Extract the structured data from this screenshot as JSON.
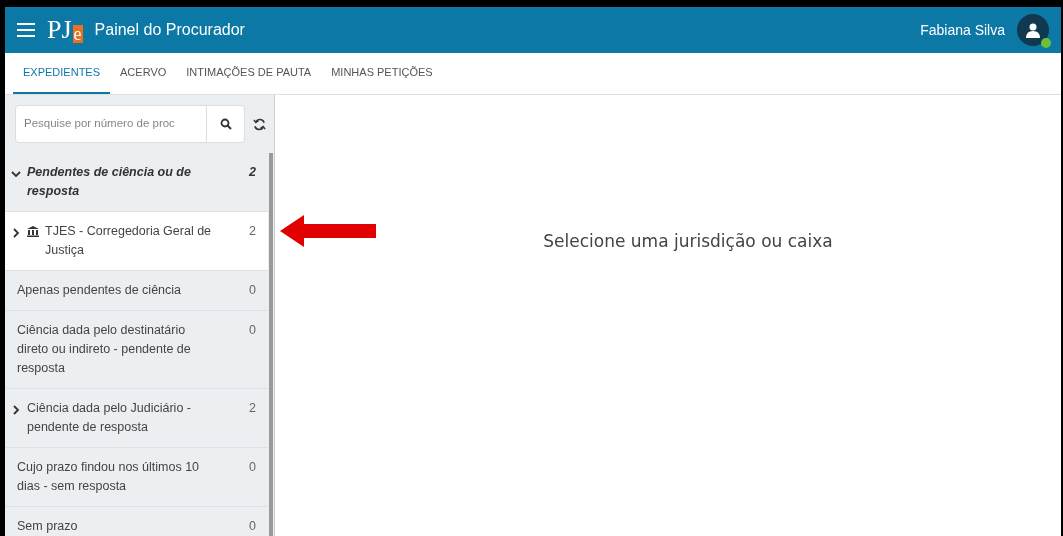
{
  "header": {
    "logo_p": "P",
    "logo_j": "J",
    "logo_e": "e",
    "title": "Painel do Procurador",
    "user": "Fabiana Silva",
    "online": true
  },
  "tabs": [
    {
      "label": "EXPEDIENTES",
      "selected": true
    },
    {
      "label": "ACERVO",
      "selected": false
    },
    {
      "label": "INTIMAÇÕES DE PAUTA",
      "selected": false
    },
    {
      "label": "MINHAS PETIÇÕES",
      "selected": false
    }
  ],
  "search": {
    "placeholder": "Pesquise por número de proc"
  },
  "sidebar": {
    "items": [
      {
        "kind": "group",
        "label": "Pendentes de ciência ou de resposta",
        "count": "2",
        "expanded": true,
        "selected": false
      },
      {
        "kind": "jurisdiction",
        "label": "TJES - Corregedoria Geral de Justiça",
        "count": "2",
        "expanded": false,
        "selected": true
      },
      {
        "kind": "filter",
        "label": "Apenas pendentes de ciência",
        "count": "0",
        "selected": false
      },
      {
        "kind": "filter",
        "label": "Ciência dada pelo destinatário direto ou indireto - pendente de resposta",
        "count": "0",
        "selected": false
      },
      {
        "kind": "group",
        "label": "Ciência dada pelo Judiciário - pendente de resposta",
        "count": "2",
        "expanded": false,
        "selected": false
      },
      {
        "kind": "filter",
        "label": "Cujo prazo findou nos últimos 10 dias - sem resposta",
        "count": "0",
        "selected": false
      },
      {
        "kind": "filter",
        "label": "Sem prazo",
        "count": "0",
        "selected": false
      }
    ]
  },
  "main": {
    "message": "Selecione uma jurisdição ou caixa"
  }
}
